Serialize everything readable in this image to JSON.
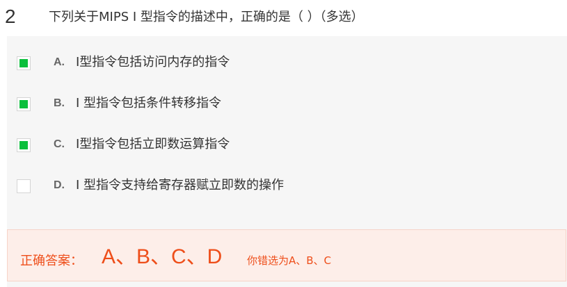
{
  "question": {
    "number": "2",
    "text": "下列关于MIPS  I 型指令的描述中，正确的是（   ）（多选）"
  },
  "options": [
    {
      "letter": "A.",
      "text": "I型指令包括访问内存的指令",
      "checked": true
    },
    {
      "letter": "B.",
      "text": "I 型指令包括条件转移指令",
      "checked": true
    },
    {
      "letter": "C.",
      "text": "I型指令包括立即数运算指令",
      "checked": true
    },
    {
      "letter": "D.",
      "text": "I 型指令支持给寄存器赋立即数的操作",
      "checked": false
    }
  ],
  "answer": {
    "label": "正确答案：",
    "value": "A、B、C、D",
    "note": "你错选为A、B、C"
  },
  "colors": {
    "checked_fill": "#0bbf3c",
    "answer_text": "#ee4e1a",
    "answer_bg": "#fdeee9",
    "option_bg": "#f6f6f6"
  }
}
